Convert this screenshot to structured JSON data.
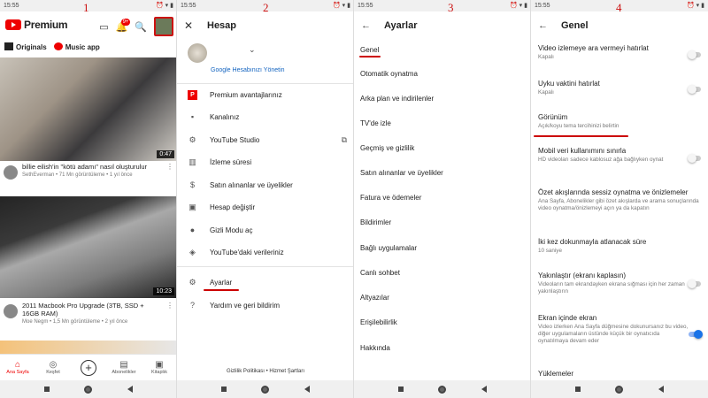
{
  "steps": [
    "1",
    "2",
    "3",
    "4"
  ],
  "status": {
    "time": "15:55",
    "icons": "⏰ ▾ ▮"
  },
  "panel1": {
    "brand": "Premium",
    "badge": "9+",
    "chips": [
      "Originals",
      "Music app"
    ],
    "videos": [
      {
        "title": "billie eilish'in \"kötü adamı\" nasıl oluşturulur",
        "channel": "SethEverman • 71 Mn görüntüleme • 1 yıl önce",
        "duration": "0:47"
      },
      {
        "title": "2011 Macbook Pro Upgrade (3TB, SSD + 16GB RAM)",
        "channel": "Moe Negm • 1,5 Mn görüntüleme • 2 yıl önce",
        "duration": "10:23"
      }
    ],
    "tabs": [
      "Ana Sayfa",
      "Keşfet",
      "",
      "Abonelikler",
      "Kitaplık"
    ]
  },
  "panel2": {
    "title": "Hesap",
    "manage": "Google Hesabınızı Yönetin",
    "items": [
      "Premium avantajlarınız",
      "Kanalınız",
      "YouTube Studio",
      "İzleme süresi",
      "Satın alınanlar ve üyelikler",
      "Hesap değiştir",
      "Gizli Modu aç",
      "YouTube'daki verileriniz",
      "Ayarlar",
      "Yardım ve geri bildirim"
    ],
    "footer": "Gizlilik Politikası  •  Hizmet Şartları"
  },
  "panel3": {
    "title": "Ayarlar",
    "items": [
      "Genel",
      "Otomatik oynatma",
      "Arka plan ve indirilenler",
      "TV'de izle",
      "Geçmiş ve gizlilik",
      "Satın alınanlar ve üyelikler",
      "Fatura ve ödemeler",
      "Bildirimler",
      "Bağlı uygulamalar",
      "Canlı sohbet",
      "Altyazılar",
      "Erişilebilirlik",
      "Hakkında"
    ]
  },
  "panel4": {
    "title": "Genel",
    "items": [
      {
        "title": "Video izlemeye ara vermeyi hatırlat",
        "sub": "Kapalı",
        "toggle": false
      },
      {
        "title": "Uyku vaktini hatırlat",
        "sub": "Kapalı",
        "toggle": false
      },
      {
        "title": "Görünüm",
        "sub": "Açık/koyu tema tercihinizi belirtin"
      },
      {
        "title": "Mobil veri kullanımını sınırla",
        "sub": "HD videoları sadece kablosuz ağa bağlıyken oynat",
        "toggle": false
      },
      {
        "title": "Özet akışlarında sessiz oynatma ve önizlemeler",
        "sub": "Ana Sayfa, Abonelikler gibi özet akışlarda ve arama sonuçlarında video oynatma/önizlemeyi açın ya da kapatın"
      },
      {
        "title": "İki kez dokunmayla atlanacak süre",
        "sub": "10 saniye"
      },
      {
        "title": "Yakınlaştır (ekranı kaplasın)",
        "sub": "Videoların tam ekrandayken ekrana sığması için her zaman yakınlaştırın",
        "toggle": false
      },
      {
        "title": "Ekran içinde ekran",
        "sub": "Video izlerken Ana Sayfa düğmesine dokunursanız bu video, diğer uygulamaların üstünde küçük bir oynatıcıda oynatılmaya devam eder",
        "toggle": true
      },
      {
        "title": "Yüklemeler",
        "sub": ""
      }
    ]
  }
}
